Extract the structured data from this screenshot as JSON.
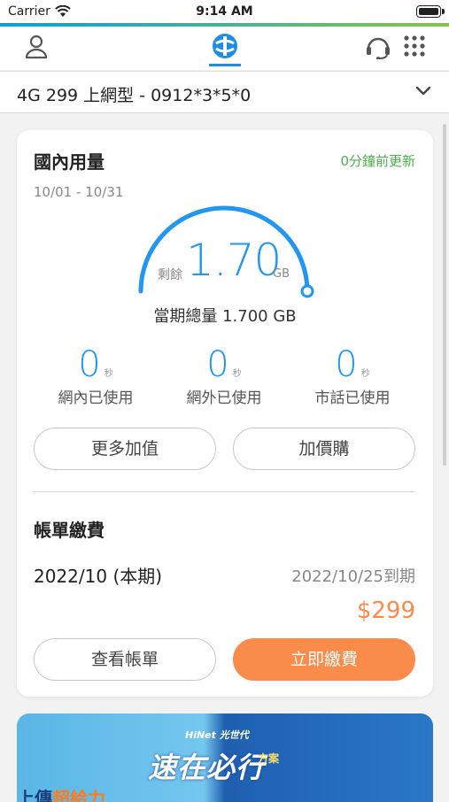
{
  "status_bar": {
    "carrier": "Carrier",
    "time": "9:14 AM"
  },
  "plan_selector": {
    "label": "4G 299 上網型 - 0912*3*5*0"
  },
  "usage": {
    "title": "國內用量",
    "updated": "0分鐘前更新",
    "period": "10/01 - 10/31",
    "remaining_label": "剩餘",
    "remaining_value": "1.70",
    "remaining_unit": "GB",
    "remaining_fraction": 1.0,
    "total_label": "當期總量 1.700 GB",
    "stats": [
      {
        "value": "0",
        "unit": "秒",
        "label": "網內已使用"
      },
      {
        "value": "0",
        "unit": "秒",
        "label": "網外已使用"
      },
      {
        "value": "0",
        "unit": "秒",
        "label": "市話已使用"
      }
    ],
    "buttons": {
      "more": "更多加值",
      "addon": "加價購"
    }
  },
  "billing": {
    "title": "帳單繳費",
    "period": "2022/10 (本期)",
    "due": "2022/10/25到期",
    "amount": "$299",
    "buttons": {
      "view": "查看帳單",
      "pay": "立即繳費"
    }
  },
  "banner": {
    "brand": "HiNet 光世代",
    "slogan": "速在必行",
    "sub": "方案",
    "bottom_prefix": "上傳",
    "bottom_highlight": "超給力"
  },
  "colors": {
    "accent_blue": "#2196f3",
    "orange": "#f98b4b",
    "green": "#4cae4c"
  },
  "icons": [
    "wifi-icon",
    "battery-icon",
    "user-icon",
    "cht-logo-icon",
    "headset-icon",
    "grid-menu-icon",
    "chevron-down-icon"
  ]
}
